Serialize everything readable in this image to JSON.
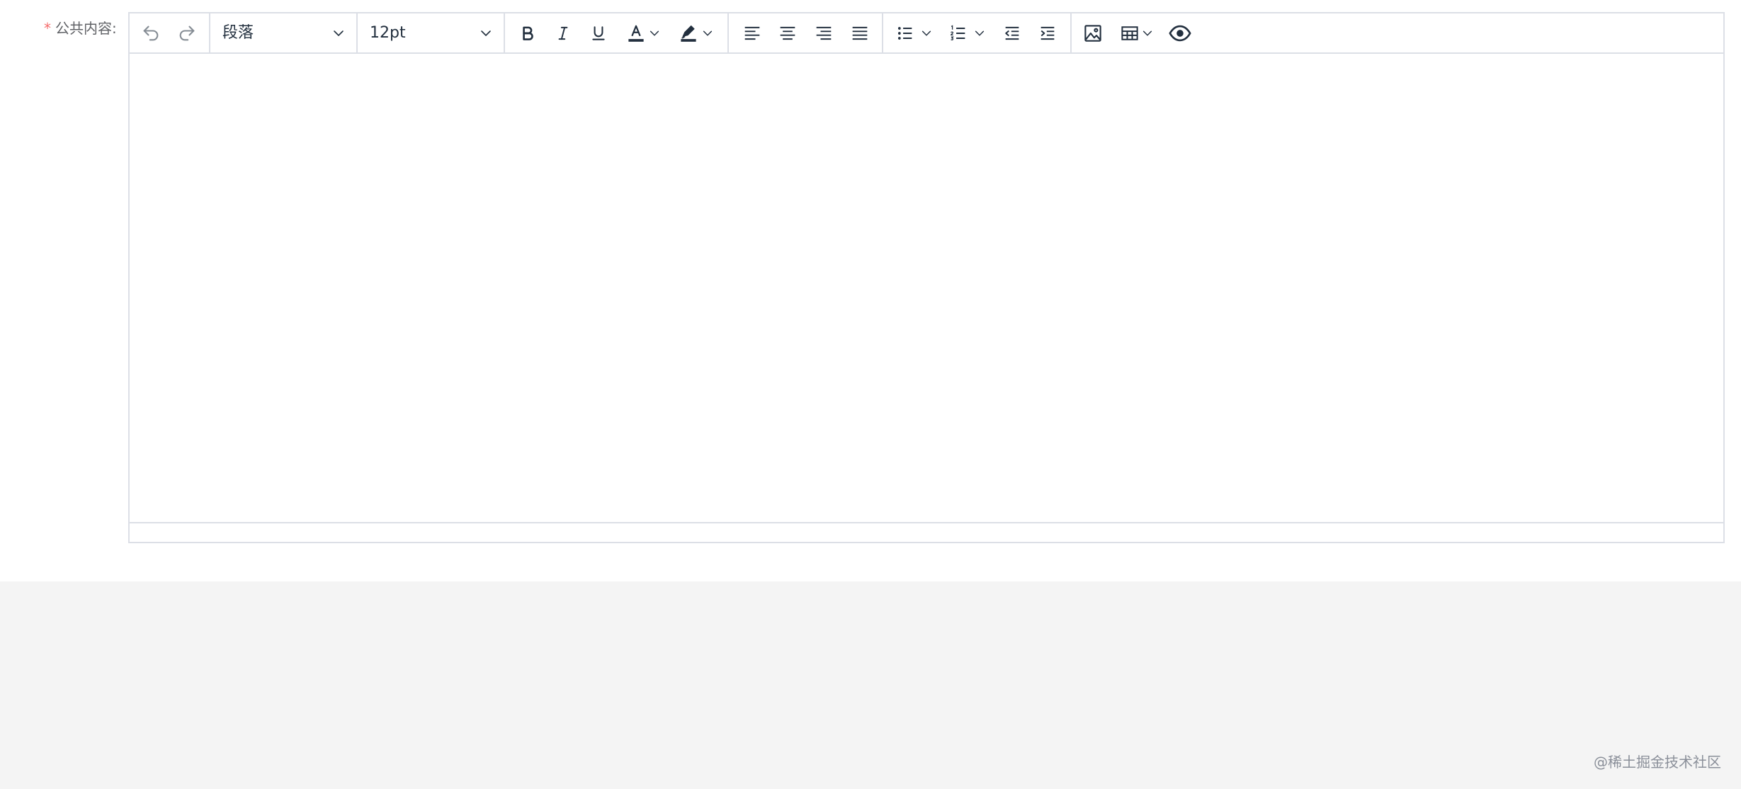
{
  "form": {
    "required_mark": "*",
    "label": "公共内容:"
  },
  "toolbar": {
    "undo": {
      "icon": "undo-icon",
      "enabled": false
    },
    "redo": {
      "icon": "redo-icon",
      "enabled": false
    },
    "block_format": {
      "value": "段落"
    },
    "font_size": {
      "value": "12pt"
    },
    "bold": {
      "icon": "bold-icon"
    },
    "italic": {
      "icon": "italic-icon"
    },
    "underline": {
      "icon": "underline-icon"
    },
    "text_color": {
      "icon": "text-color-icon",
      "color": "#222f3e"
    },
    "highlight_color": {
      "icon": "highlight-icon",
      "color": "#222f3e"
    },
    "align_left": {
      "icon": "align-left-icon"
    },
    "align_center": {
      "icon": "align-center-icon"
    },
    "align_right": {
      "icon": "align-right-icon"
    },
    "align_justify": {
      "icon": "align-justify-icon"
    },
    "bullet_list": {
      "icon": "bullet-list-icon"
    },
    "numbered_list": {
      "icon": "numbered-list-icon"
    },
    "outdent": {
      "icon": "outdent-icon"
    },
    "indent": {
      "icon": "indent-icon"
    },
    "image": {
      "icon": "image-icon"
    },
    "table": {
      "icon": "table-icon"
    },
    "preview": {
      "icon": "eye-icon"
    }
  },
  "editor": {
    "content": ""
  },
  "watermark": "@稀土掘金技术社区",
  "colors": {
    "icon": "#222f3e",
    "border": "#dcdfe6",
    "page_background": "#f4f4f4",
    "required": "#f56c6c",
    "label": "#606266"
  }
}
